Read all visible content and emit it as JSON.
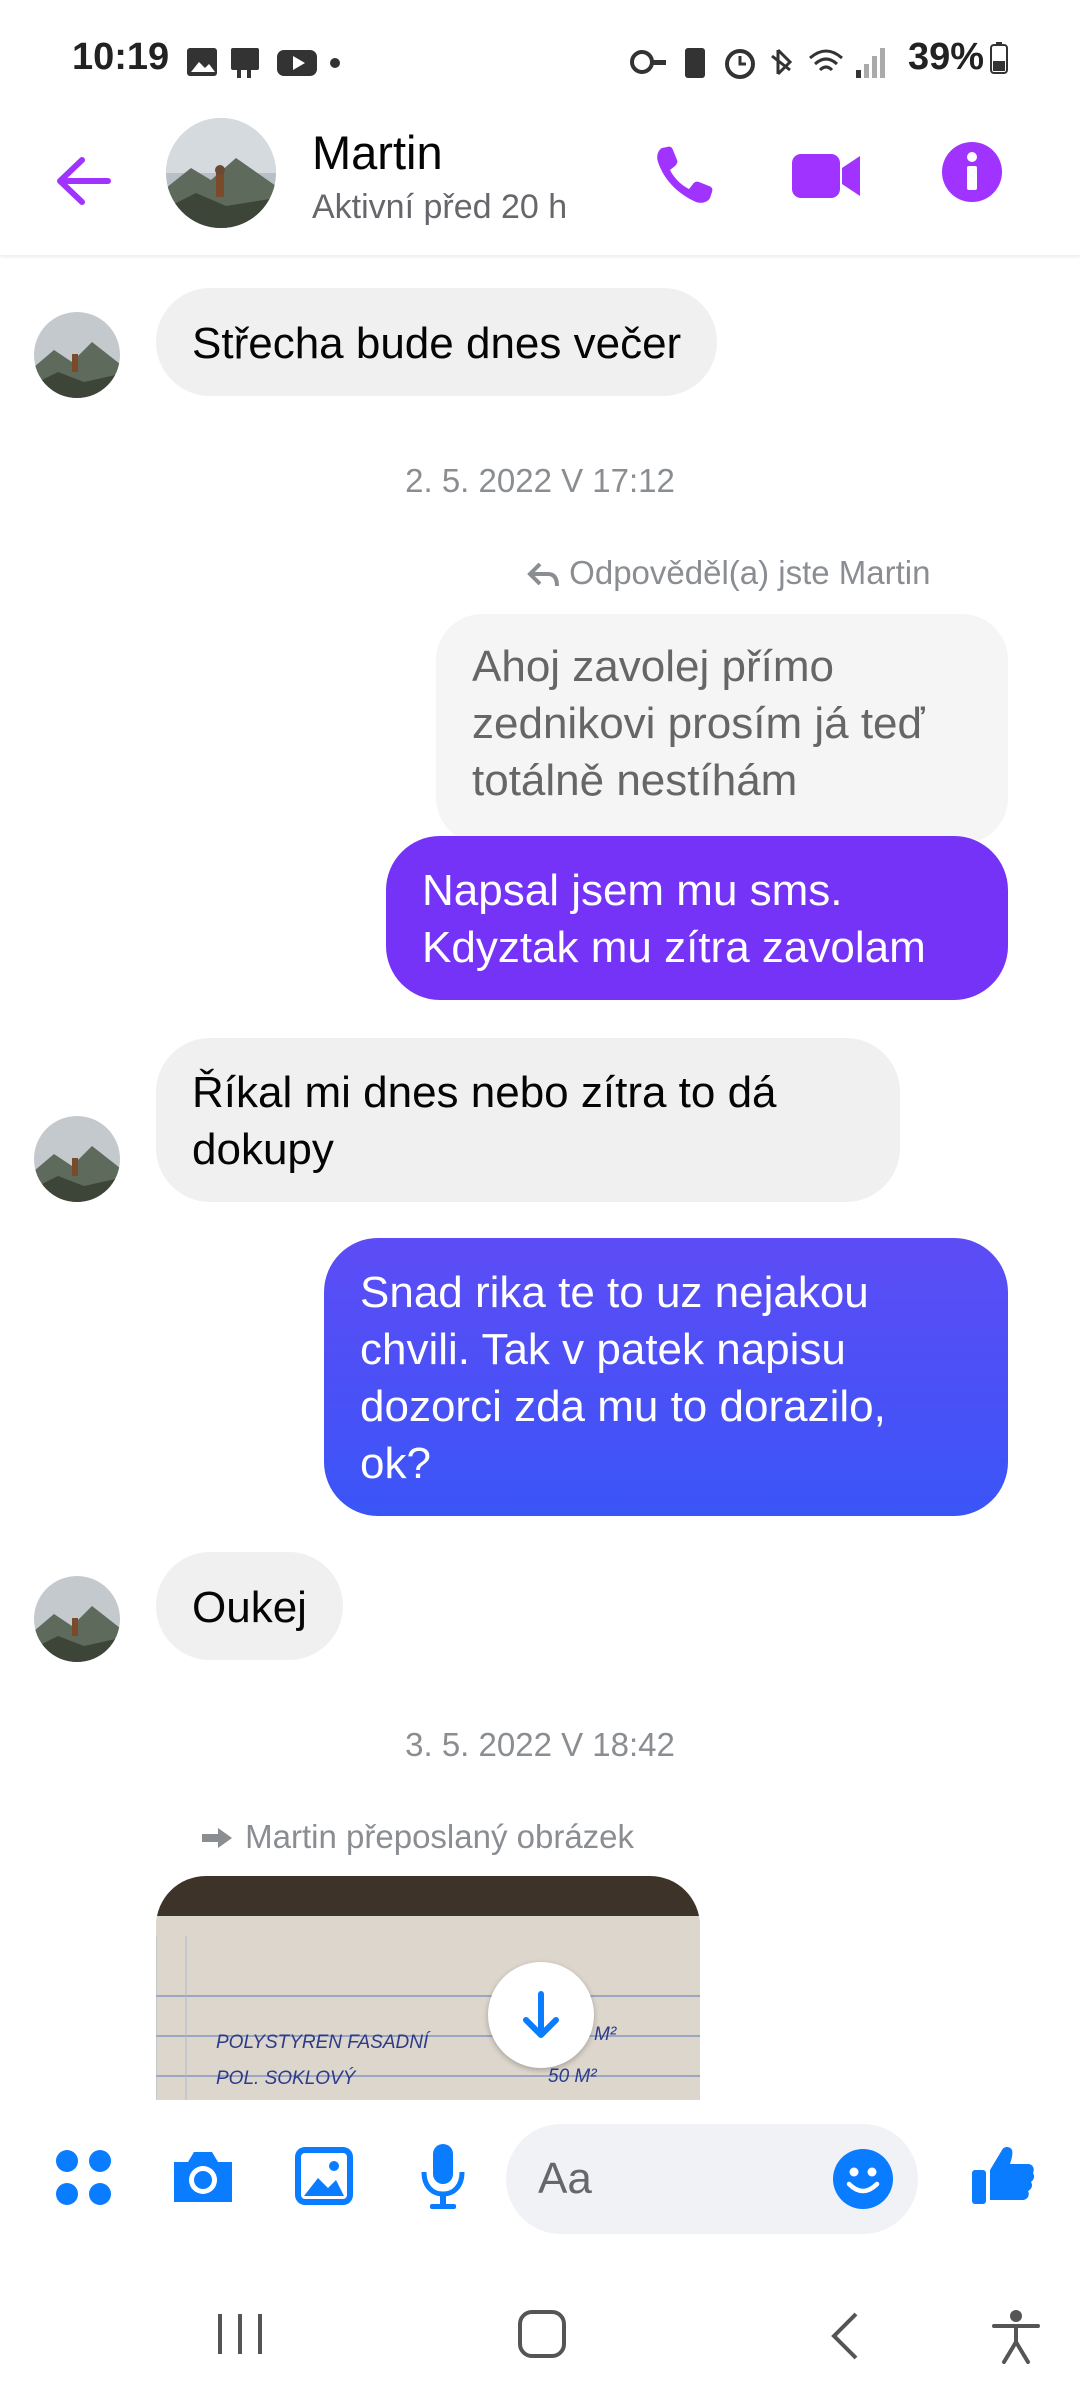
{
  "status_bar": {
    "time": "10:19",
    "battery": "39%"
  },
  "header": {
    "name": "Martin",
    "status": "Aktivní před 20 h"
  },
  "messages": {
    "m1": "Střecha bude dnes večer",
    "stamp1": "2. 5. 2022 V 17:12",
    "reply_note": "Odpověděl(a) jste Martin",
    "quoted": [
      "Ahoj zavolej přímo",
      "zednikovi prosím já teď",
      "totálně nestíhám"
    ],
    "m2": [
      "Napsal jsem mu sms.",
      "Kdyztak mu zítra zavolam"
    ],
    "m3": [
      "Říkal mi dnes nebo zítra to dá",
      "dokupy"
    ],
    "m4": [
      "Snad rika te to uz nejakou",
      "chvili. Tak v patek napisu",
      "dozorci zda mu to dorazilo,",
      "ok?"
    ],
    "m5": "Oukej",
    "stamp2": "3. 5. 2022 V 18:42",
    "forward_note": "Martin přeposlaný obrázek",
    "image_text": [
      "POLYSTYREN  FASADNÍ",
      "POL.  SOKLOVÝ",
      "M²",
      "50 M²"
    ]
  },
  "composer": {
    "placeholder": "Aa"
  },
  "colors": {
    "accent": "#a033ff",
    "out_bubble_1": "#7533f8",
    "out_bubble_2": "#3a55f7",
    "composer_icons": "#0a7cff"
  }
}
